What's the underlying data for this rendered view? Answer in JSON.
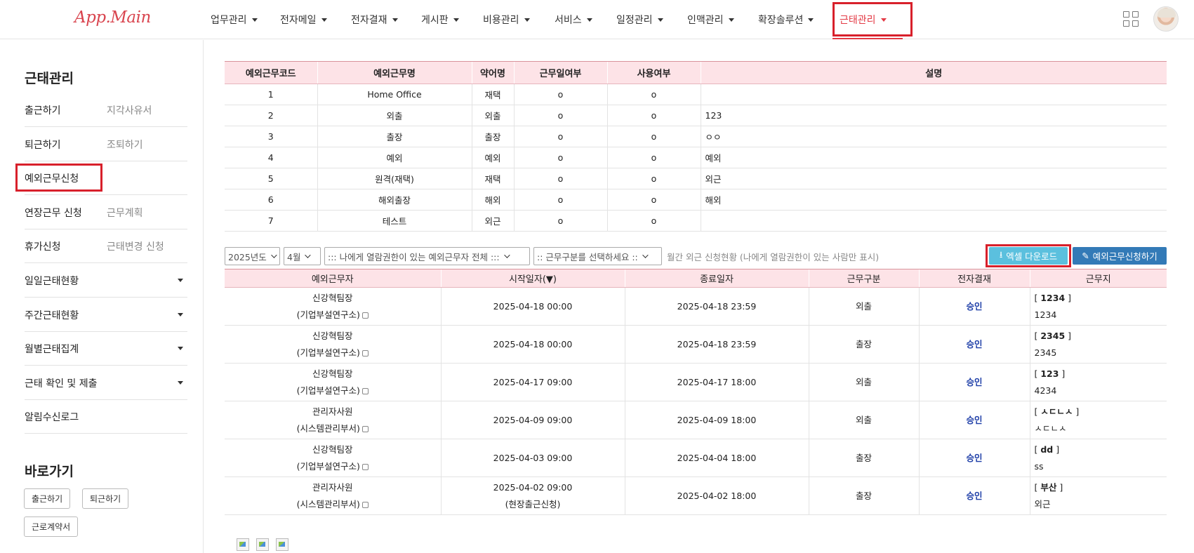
{
  "header": {
    "logo": "App.Main",
    "nav": [
      {
        "label": "업무관리"
      },
      {
        "label": "전자메일"
      },
      {
        "label": "전자결재"
      },
      {
        "label": "게시판"
      },
      {
        "label": "비용관리"
      },
      {
        "label": "서비스"
      },
      {
        "label": "일정관리"
      },
      {
        "label": "인맥관리"
      },
      {
        "label": "확장솔루션"
      },
      {
        "label": "근태관리",
        "active": true
      }
    ]
  },
  "sidebar": {
    "title": "근태관리",
    "rows": [
      {
        "main": "출근하기",
        "sub": "지각사유서"
      },
      {
        "main": "퇴근하기",
        "sub": "조퇴하기"
      },
      {
        "main": "예외근무신청",
        "sub": ""
      },
      {
        "main": "연장근무 신청",
        "sub": "근무계획"
      },
      {
        "main": "휴가신청",
        "sub": "근태변경 신청"
      },
      {
        "main": "일일근태현황",
        "sub": ""
      },
      {
        "main": "주간근태현황",
        "sub": ""
      },
      {
        "main": "월별근태집계",
        "sub": ""
      },
      {
        "main": "근태 확인 및 제출",
        "sub": ""
      },
      {
        "main": "알림수신로그",
        "sub": ""
      }
    ],
    "shortcut_title": "바로가기",
    "shortcuts": [
      "출근하기",
      "퇴근하기",
      "근로계약서"
    ]
  },
  "code_table": {
    "headers": [
      "예외근무코드",
      "예외근무명",
      "약어명",
      "근무일여부",
      "사용여부",
      "설명"
    ],
    "rows": [
      [
        "1",
        "Home Office",
        "재택",
        "o",
        "o",
        ""
      ],
      [
        "2",
        "외출",
        "외출",
        "o",
        "o",
        "123"
      ],
      [
        "3",
        "출장",
        "출장",
        "o",
        "o",
        "ㅇㅇ"
      ],
      [
        "4",
        "예외",
        "예외",
        "o",
        "o",
        "예외"
      ],
      [
        "5",
        "원격(재택)",
        "재택",
        "o",
        "o",
        "외근"
      ],
      [
        "6",
        "해외출장",
        "해외",
        "o",
        "o",
        "해외"
      ],
      [
        "7",
        "테스트",
        "외근",
        "o",
        "o",
        ""
      ]
    ]
  },
  "filters": {
    "year": "2025년도",
    "month": "4월",
    "person": "::: 나에게 열람권한이 있는 예외근무자 전체 :::",
    "work_type": ":: 근무구분를 선택하세요 ::",
    "note": "월간 외근 신청현황 (나에게 열람권한이 있는 사람만 표시)",
    "excel_label": "엑셀 다운로드",
    "apply_label": "예외근무신청하기"
  },
  "request_table": {
    "headers": [
      "예외근무자",
      "시작일자(▼)",
      "종료일자",
      "근무구분",
      "전자결재",
      "근무지"
    ],
    "rows": [
      {
        "name": "신강혁팀장",
        "dept": "(기업부설연구소)",
        "start": "2025-04-18 00:00",
        "start_note": "",
        "end": "2025-04-18 23:59",
        "type": "외출",
        "approval": "승인",
        "place_code": "1234",
        "place": "1234"
      },
      {
        "name": "신강혁팀장",
        "dept": "(기업부설연구소)",
        "start": "2025-04-18 00:00",
        "start_note": "",
        "end": "2025-04-18 23:59",
        "type": "출장",
        "approval": "승인",
        "place_code": "2345",
        "place": "2345"
      },
      {
        "name": "신강혁팀장",
        "dept": "(기업부설연구소)",
        "start": "2025-04-17 09:00",
        "start_note": "",
        "end": "2025-04-17 18:00",
        "type": "외출",
        "approval": "승인",
        "place_code": "123",
        "place": "4234"
      },
      {
        "name": "관리자사원",
        "dept": "(시스템관리부서)",
        "start": "2025-04-09 09:00",
        "start_note": "",
        "end": "2025-04-09 18:00",
        "type": "외출",
        "approval": "승인",
        "place_code": "ㅅㄷㄴㅅ",
        "place": "ㅅㄷㄴㅅ"
      },
      {
        "name": "신강혁팀장",
        "dept": "(기업부설연구소)",
        "start": "2025-04-03 09:00",
        "start_note": "",
        "end": "2025-04-04 18:00",
        "type": "출장",
        "approval": "승인",
        "place_code": "dd",
        "place": "ss"
      },
      {
        "name": "관리자사원",
        "dept": "(시스템관리부서)",
        "start": "2025-04-02 09:00",
        "start_note": "(현장출근신청)",
        "end": "2025-04-02 18:00",
        "type": "출장",
        "approval": "승인",
        "place_code": "부산",
        "place": "외근"
      }
    ]
  },
  "colors": {
    "brand": "#d9454f",
    "active_nav": "#e33a45",
    "header_bg": "#fde3e7",
    "highlight": "#d8202b",
    "approve": "#1f3fa8",
    "excel_btn": "#5bc0de",
    "apply_btn": "#337ab7"
  }
}
